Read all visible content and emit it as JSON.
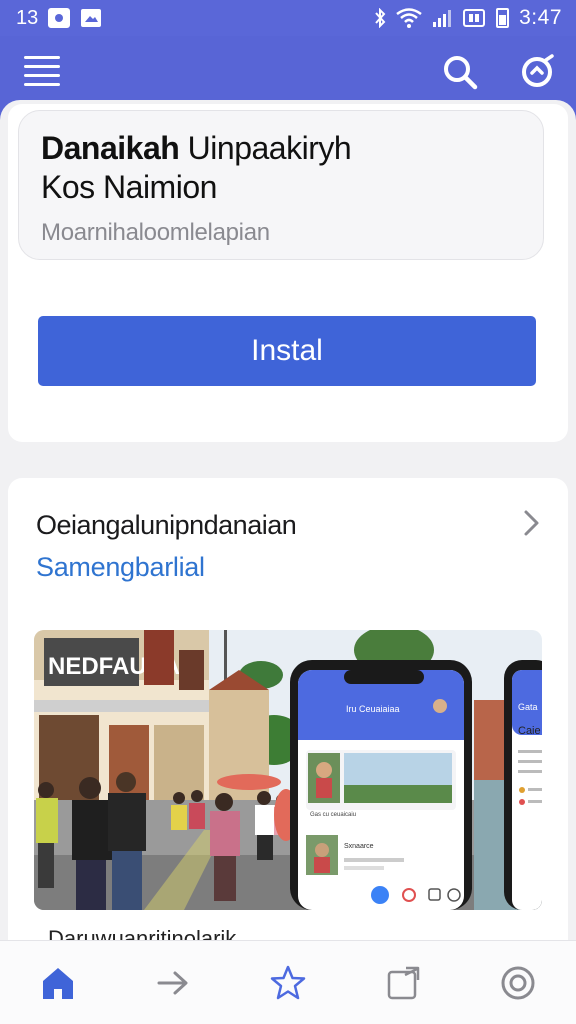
{
  "status_bar": {
    "left_number": "13",
    "time": "3:47"
  },
  "app": {
    "title_bold": "Danaikah",
    "title_rest": " Uinpaakiryh",
    "subtitle": "Kos Naimion",
    "developer": "Moarnihaloomlelapian",
    "install_label": "Instal"
  },
  "section": {
    "title": "Oeiangalunipndanaian",
    "link": "Samengbarlial",
    "caption": "Daruwuanritinolarik"
  },
  "screenshot": {
    "sign_text": "NEDFAUSA",
    "phone_header": "Iru Ceuaiaiaa",
    "phone_list_title": "Gas cu ceuaicaiu",
    "phone_post_text": "Sxnaarce",
    "phone2_title": "Gata",
    "phone2_label": "Caie"
  },
  "colors": {
    "brand": "#5865d6",
    "install": "#3f64d8",
    "link": "#2f74d0",
    "nav_active": "#3f64d8",
    "nav_inactive": "#8a8a90"
  },
  "icons": [
    "menu-icon",
    "search-icon",
    "scan-icon",
    "chevron-right-icon",
    "home-icon",
    "forward-icon",
    "star-icon",
    "note-icon",
    "target-icon"
  ]
}
